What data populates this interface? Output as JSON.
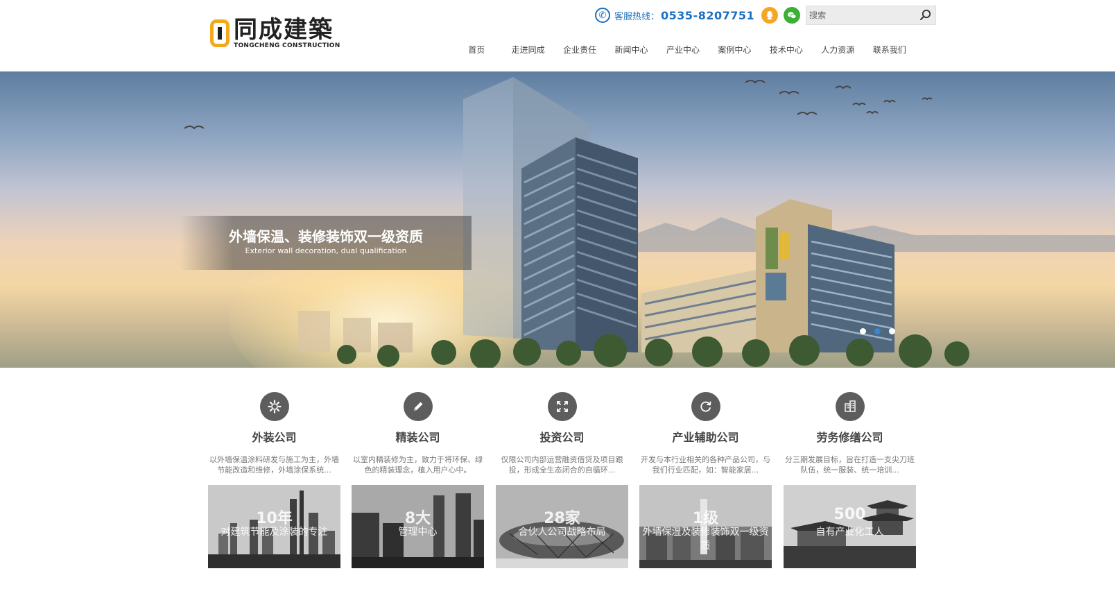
{
  "brand": {
    "name_cn": "同成建築",
    "name_en": "TONGCHENG CONSTRUCTION",
    "accent_color": "#f3a91c"
  },
  "topbar": {
    "hotline_label": "客服热线：",
    "hotline_number": "0535-8207751",
    "search_placeholder": "搜索",
    "icons": [
      "phone-icon",
      "qq-icon",
      "wechat-icon",
      "search-icon"
    ],
    "link_color": "#1d6fbf"
  },
  "nav": {
    "items": [
      "首页",
      "走进同成",
      "企业责任",
      "新闻中心",
      "产业中心",
      "案例中心",
      "技术中心",
      "人力资源",
      "联系我们"
    ]
  },
  "banner": {
    "title": "外墙保温、装修装饰双一级资质",
    "subtitle": "Exterior wall decoration, dual qualification",
    "slide_count": 3,
    "active_slide": 2
  },
  "services": [
    {
      "icon": "gear-icon",
      "title": "外装公司",
      "desc": "以外墙保温涂料研发与施工为主，外墙节能改造和维修，外墙涂保系统...",
      "stat_big": "10年",
      "stat_small": "对建筑节能及涂装的专注"
    },
    {
      "icon": "pencil-icon",
      "title": "精装公司",
      "desc": "以室内精装修为主，致力于将环保、绿色的精装理念，植入用户心中。",
      "stat_big": "8大",
      "stat_small": "管理中心"
    },
    {
      "icon": "expand-icon",
      "title": "投资公司",
      "desc": "仅限公司内部运营融资借贷及项目跟投，形成全生态闭合的自循环...",
      "stat_big": "28家",
      "stat_small": "合伙人公司战略布局"
    },
    {
      "icon": "refresh-icon",
      "title": "产业辅助公司",
      "desc": "开发与本行业相关的各种产品公司，与我们行业匹配，如：智能家居...",
      "stat_big": "1级",
      "stat_small": "外墙保温及装修装饰双一级资质"
    },
    {
      "icon": "building-icon",
      "title": "劳务修缮公司",
      "desc": "分三期发展目标，旨在打造一支尖刀班队伍，统一服装、统一培训...",
      "stat_big": "500",
      "stat_small": "自有产业化工人"
    }
  ]
}
